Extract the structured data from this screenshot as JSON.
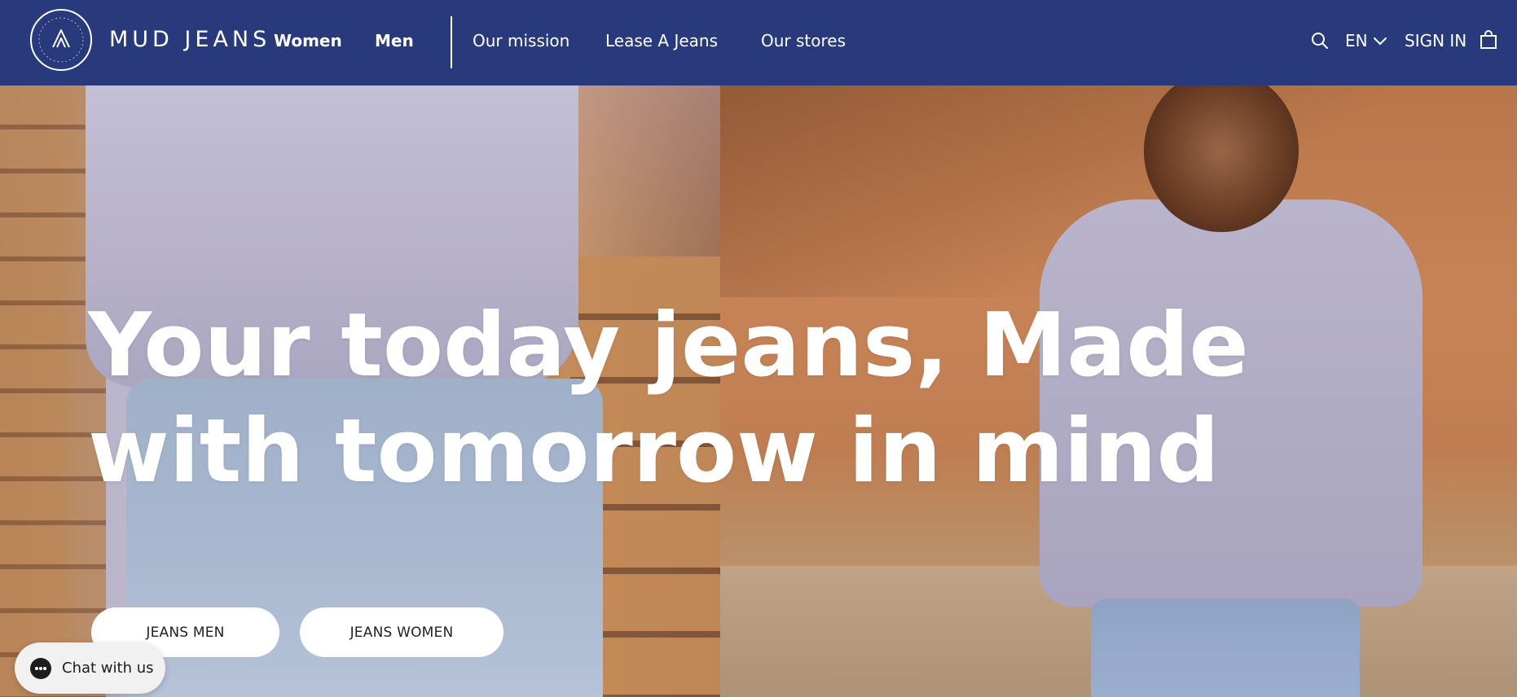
{
  "header": {
    "logo_circle_text": "MUD JEANS CIRCULAR",
    "brand": "MUD JEANS",
    "nav_primary": [
      {
        "label": "Women"
      },
      {
        "label": "Men"
      }
    ],
    "nav_secondary": [
      {
        "label": "Our mission"
      },
      {
        "label": "Lease A Jeans"
      },
      {
        "label": "Our stores"
      }
    ],
    "search_icon": "search-icon",
    "language": "EN",
    "sign_in": "SIGN IN",
    "cart_icon": "shopping-bag-icon"
  },
  "hero": {
    "headline": "Your today jeans, Made with tomorrow in mind",
    "cta_men": "JEANS MEN",
    "cta_women": "JEANS WOMEN"
  },
  "chat": {
    "label": "Chat with us"
  },
  "colors": {
    "header_bg": "#283a7c",
    "text_light": "#ffffff",
    "button_bg": "#ffffff",
    "button_text": "#222222"
  }
}
